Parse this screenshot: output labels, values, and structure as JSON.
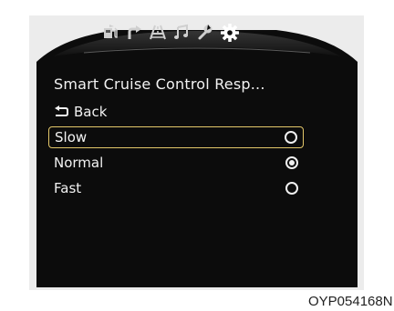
{
  "tabs": [
    {
      "icon": "fuel-pump-icon",
      "active": false
    },
    {
      "icon": "turn-arrow-icon",
      "active": false
    },
    {
      "icon": "lane-road-icon",
      "active": false
    },
    {
      "icon": "music-note-icon",
      "active": false
    },
    {
      "icon": "wrench-icon",
      "active": false
    },
    {
      "icon": "gear-icon",
      "active": true
    }
  ],
  "screen": {
    "title": "Smart Cruise Control Resp...",
    "back_label": "Back"
  },
  "options": [
    {
      "label": "Slow",
      "checked": false,
      "highlighted": true
    },
    {
      "label": "Normal",
      "checked": true,
      "highlighted": false
    },
    {
      "label": "Fast",
      "checked": false,
      "highlighted": false
    }
  ],
  "caption": "OYP054168N",
  "colors": {
    "highlight": "#e3c76a",
    "text": "#f2f2f2",
    "screen_bg": "#0c0c0c",
    "panel_bg": "#ececec"
  }
}
